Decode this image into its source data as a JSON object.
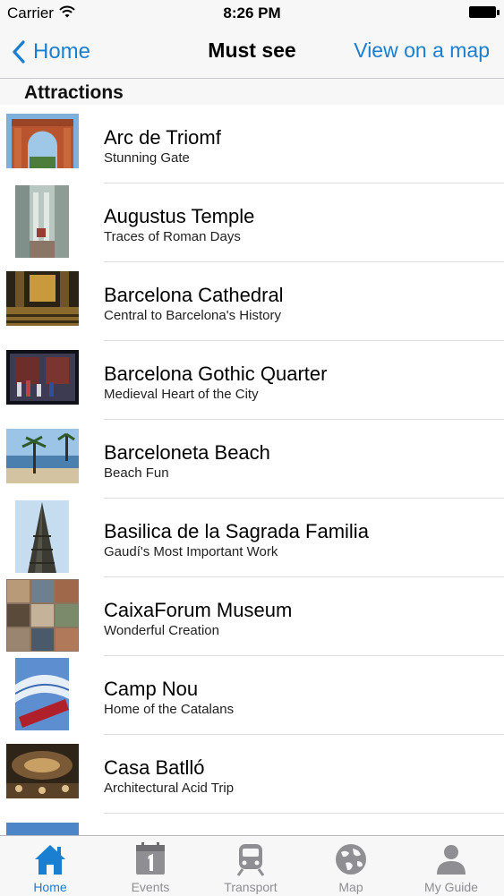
{
  "status_bar": {
    "carrier": "Carrier",
    "time": "8:26 PM"
  },
  "nav": {
    "back_label": "Home",
    "title": "Must see",
    "right_label": "View on a map"
  },
  "section": {
    "title": "Attractions"
  },
  "items": [
    {
      "title": "Arc de Triomf",
      "subtitle": "Stunning Gate"
    },
    {
      "title": "Augustus Temple",
      "subtitle": "Traces of Roman Days"
    },
    {
      "title": "Barcelona Cathedral",
      "subtitle": "Central to Barcelona's History"
    },
    {
      "title": "Barcelona Gothic Quarter",
      "subtitle": "Medieval Heart of the City"
    },
    {
      "title": "Barceloneta Beach",
      "subtitle": "Beach Fun"
    },
    {
      "title": "Basilica de la Sagrada Familia",
      "subtitle": "Gaudí's Most Important Work"
    },
    {
      "title": "CaixaForum Museum",
      "subtitle": "Wonderful Creation"
    },
    {
      "title": "Camp Nou",
      "subtitle": "Home of the Catalans"
    },
    {
      "title": "Casa Batlló",
      "subtitle": "Architectural Acid Trip"
    }
  ],
  "tabs": [
    {
      "label": "Home",
      "icon": "home-icon",
      "active": true
    },
    {
      "label": "Events",
      "icon": "calendar-icon",
      "active": false
    },
    {
      "label": "Transport",
      "icon": "train-icon",
      "active": false
    },
    {
      "label": "Map",
      "icon": "globe-icon",
      "active": false
    },
    {
      "label": "My Guide",
      "icon": "person-icon",
      "active": false
    }
  ],
  "colors": {
    "accent": "#1a7fd0",
    "inactive": "#8e8e93"
  }
}
